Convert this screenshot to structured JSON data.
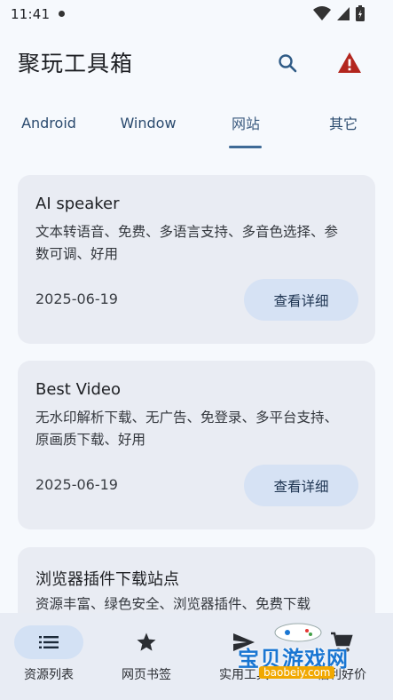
{
  "status_bar": {
    "time": "11:41"
  },
  "app_bar": {
    "title": "聚玩工具箱"
  },
  "tabs": [
    {
      "label": "Android"
    },
    {
      "label": "Window"
    },
    {
      "label": "网站"
    },
    {
      "label": "其它"
    }
  ],
  "cards": [
    {
      "title": "AI speaker",
      "desc": "文本转语音、免费、多语言支持、多音色选择、参数可调、好用",
      "date": "2025-06-19",
      "button": "查看详细"
    },
    {
      "title": "Best Video",
      "desc": "无水印解析下载、无广告、免登录、多平台支持、原画质下载、好用",
      "date": "2025-06-19",
      "button": "查看详细"
    },
    {
      "title": "浏览器插件下载站点",
      "desc": "资源丰富、绿色安全、浏览器插件、免费下载"
    }
  ],
  "bottom_nav": [
    {
      "label": "资源列表",
      "icon": "list-icon"
    },
    {
      "label": "网页书签",
      "icon": "star-icon"
    },
    {
      "label": "实用工具",
      "icon": "send-icon"
    },
    {
      "label": "福利好价",
      "icon": "cart-icon"
    }
  ],
  "watermark": {
    "text": "宝贝游戏网",
    "url": "baobeiy.com"
  },
  "colors": {
    "accent": "#3e6a96",
    "warning": "#b3261e",
    "card_bg": "#e9ecf3",
    "button_bg": "#d6e2f4"
  }
}
